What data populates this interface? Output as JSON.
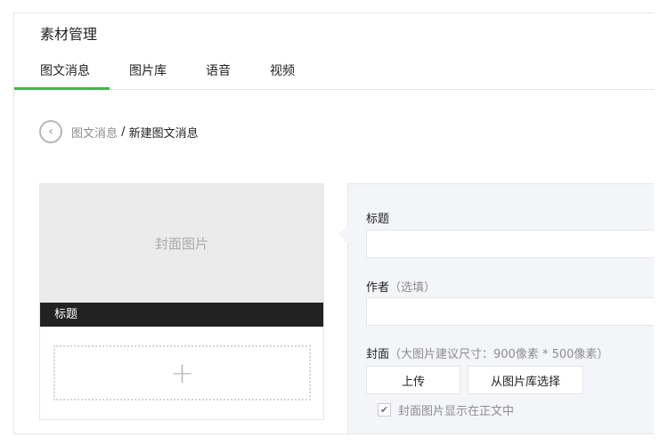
{
  "header": {
    "title": "素材管理"
  },
  "tabs": [
    {
      "label": "图文消息",
      "active": true
    },
    {
      "label": "图片库"
    },
    {
      "label": "语音"
    },
    {
      "label": "视频"
    }
  ],
  "breadcrumb": {
    "parent": "图文消息",
    "separator": " / ",
    "current": "新建图文消息"
  },
  "preview": {
    "cover_placeholder": "封面图片",
    "title": "标题",
    "add_symbol": "+"
  },
  "form": {
    "title_label": "标题",
    "title_value": "",
    "author_label": "作者",
    "author_hint": "（选填）",
    "author_value": "",
    "cover_label": "封面",
    "cover_hint": "（大图片建议尺寸：900像素 * 500像素）",
    "upload_button": "上传",
    "library_button": "从图片库选择",
    "show_cover_label": "封面图片显示在正文中",
    "show_cover_checked": true
  },
  "colors": {
    "accent": "#44b549",
    "panel_bg": "#f4f5f9"
  }
}
